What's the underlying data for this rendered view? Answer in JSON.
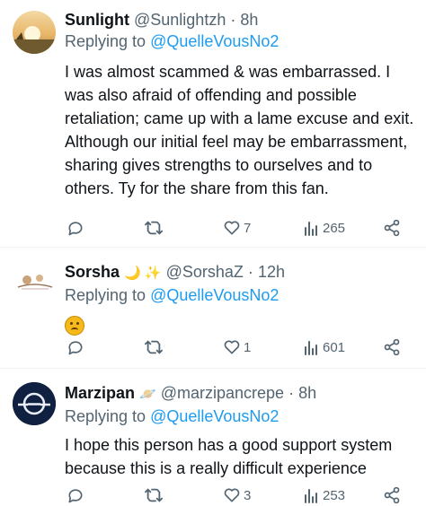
{
  "tweets": [
    {
      "name": "Sunlight",
      "handle": "@Sunlightzh",
      "time": "8h",
      "reply_prefix": "Replying to",
      "reply_to": "@QuelleVousNo2",
      "text": "I was almost scammed & was embarrassed. I was also afraid of offending and possible retaliation; came up with a lame excuse and exit. Although our initial feel may be embarrassment, sharing gives strengths to ourselves and to others. Ty for the share from this fan.",
      "likes": "7",
      "views": "265"
    },
    {
      "name": "Sorsha",
      "name_emoji": "🌙 ✨",
      "handle": "@SorshaZ",
      "time": "12h",
      "reply_prefix": "Replying to",
      "reply_to": "@QuelleVousNo2",
      "emoji": "slightly-frowning-face",
      "likes": "1",
      "views": "601"
    },
    {
      "name": "Marzipan",
      "name_emoji": "🪐",
      "handle": "@marzipancrepe",
      "time": "8h",
      "reply_prefix": "Replying to",
      "reply_to": "@QuelleVousNo2",
      "text": "I hope this person has a good support system because this is a really difficult experience",
      "likes": "3",
      "views": "253"
    }
  ],
  "separator": "·",
  "icons": [
    "reply-icon",
    "retweet-icon",
    "like-icon",
    "views-icon",
    "share-icon"
  ],
  "colors": {
    "link": "#1d9bf0",
    "secondary": "#536471",
    "text": "#0f1419"
  }
}
